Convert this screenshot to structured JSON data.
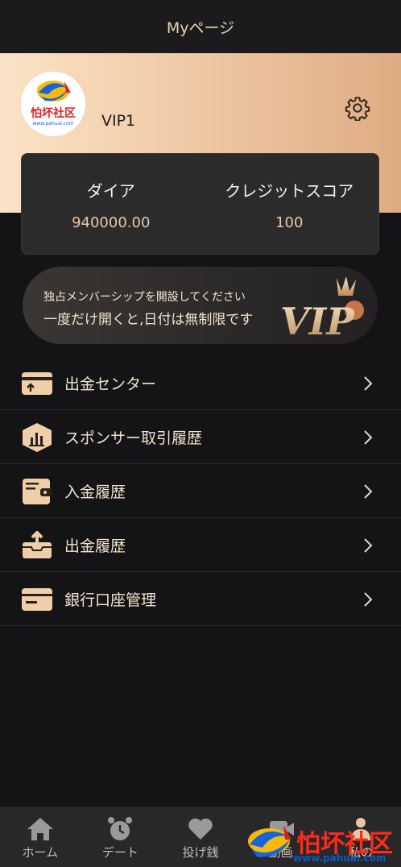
{
  "header": {
    "title": "Myページ"
  },
  "profile": {
    "level": "VIP1",
    "avatar_text": "怕坏社区",
    "avatar_url": "www.pahuai.com"
  },
  "stats": [
    {
      "label": "ダイア",
      "value": "940000.00"
    },
    {
      "label": "クレジットスコア",
      "value": "100"
    }
  ],
  "banner": {
    "line1": "独占メンバーシップを開設してください",
    "line2": "一度だけ開くと,日付は無制限です"
  },
  "menu": [
    {
      "label": "出金センター",
      "icon": "withdraw-card-icon"
    },
    {
      "label": "スポンサー取引履歴",
      "icon": "chart-hexagon-icon"
    },
    {
      "label": "入金履歴",
      "icon": "wallet-icon"
    },
    {
      "label": "出金履歴",
      "icon": "outbox-icon"
    },
    {
      "label": "銀行口座管理",
      "icon": "bank-card-icon"
    }
  ],
  "tabs": [
    {
      "label": "ホーム",
      "icon": "home-icon"
    },
    {
      "label": "デート",
      "icon": "alarm-clock-icon"
    },
    {
      "label": "投げ銭",
      "icon": "heart-icon"
    },
    {
      "label": "動画",
      "icon": "video-icon"
    },
    {
      "label": "私の",
      "icon": "person-icon"
    }
  ],
  "watermark": {
    "text": "怕坏社区",
    "url": "www.pahuai.com"
  },
  "colors": {
    "accent": "#e8c7a4",
    "background": "#141315",
    "hero_gradient_start": "#fbe3c7",
    "hero_gradient_end": "#deac83"
  }
}
